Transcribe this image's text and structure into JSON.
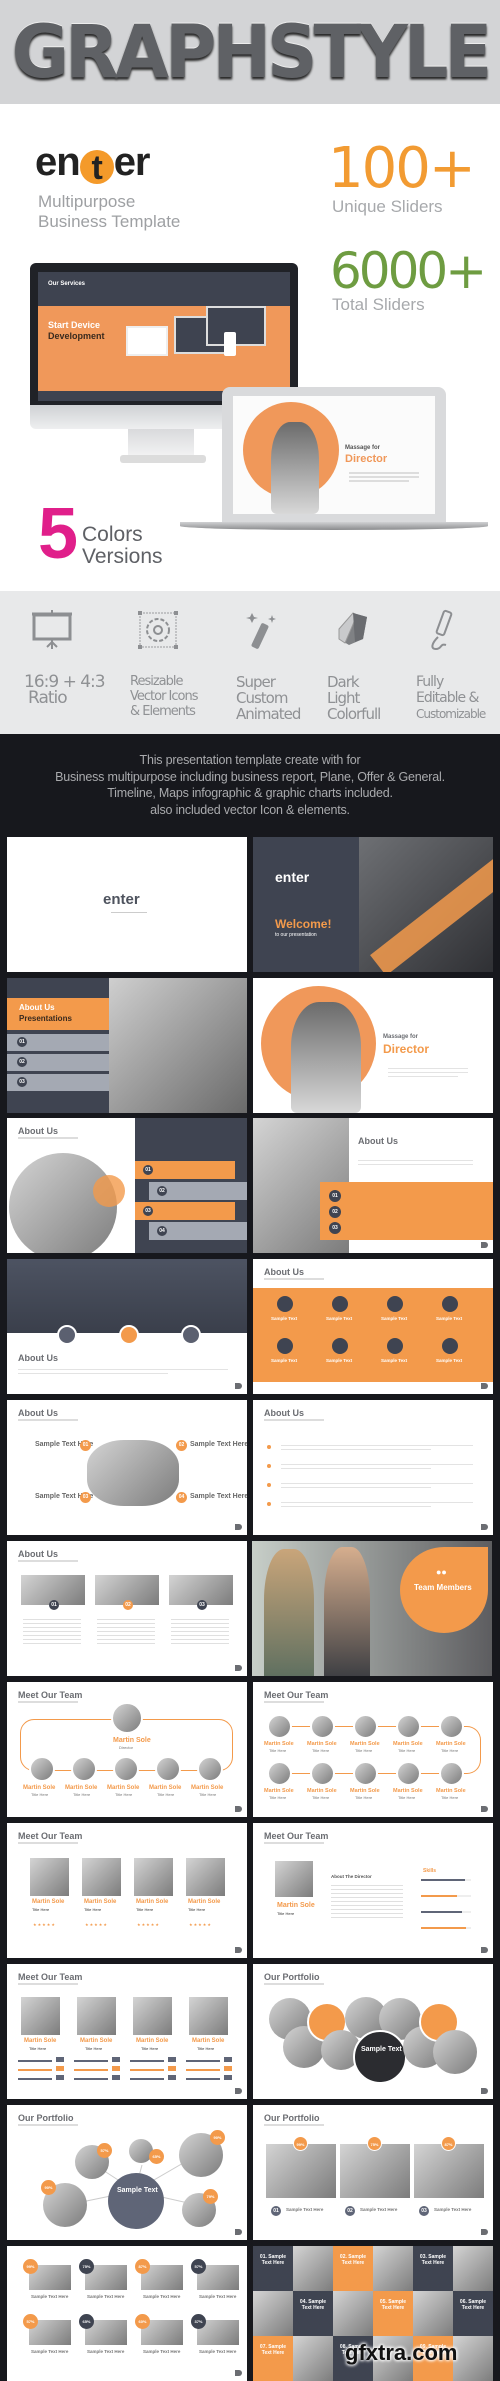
{
  "header": {
    "title": "GRAPHSTYLE"
  },
  "promo": {
    "logo_prefix": "en",
    "logo_mid": "t",
    "logo_suffix": "er",
    "tagline_line1": "Multipurpose",
    "tagline_line2": "Business Template",
    "stat1_value": "100+",
    "stat1_label": "Unique Sliders",
    "stat2_value": "6000+",
    "stat2_label": "Total Sliders",
    "colors_number": "5",
    "colors_line1": "Colors",
    "colors_line2": "Versions",
    "imac_screen": {
      "title": "Our Services",
      "heading1": "Start Device",
      "heading2": "Development"
    },
    "laptop_screen": {
      "pre": "Massage for",
      "heading": "Director"
    },
    "accent_orange": "#f39a4b",
    "accent_green": "#6e9c41",
    "accent_pink": "#e01f8a"
  },
  "features": [
    {
      "icon": "projector-screen-icon",
      "lines": [
        "16:9 + 4:3",
        "Ratio"
      ]
    },
    {
      "icon": "vector-gear-icon",
      "lines": [
        "Resizable",
        "Vector Icons",
        "& Elements"
      ]
    },
    {
      "icon": "magic-wand-icon",
      "lines": [
        "Super",
        "Custom",
        "Animated"
      ]
    },
    {
      "icon": "color-swatch-icon",
      "lines": [
        "Dark",
        "Light",
        "Colorfull"
      ]
    },
    {
      "icon": "pencil-edit-icon",
      "lines": [
        "Fully",
        "Editable &",
        "Customizable"
      ]
    }
  ],
  "description": [
    "This presentation template create with for",
    "Business multipurpose including business report, Plane, Offer & General.",
    "Timeline, Maps infographic & graphic charts included.",
    "also included vector Icon & elements."
  ],
  "slides": {
    "s1": {
      "logo": "enter"
    },
    "s2": {
      "logo": "enter",
      "heading": "Welcome!",
      "sub": "to our presentation"
    },
    "s3": {
      "heading1": "About Us",
      "heading2": "Presentations",
      "items": [
        "01",
        "02",
        "03"
      ]
    },
    "s4": {
      "pre": "Massage for",
      "heading": "Director"
    },
    "s5": {
      "title": "About Us",
      "items": [
        "01",
        "02",
        "03",
        "04"
      ]
    },
    "s6": {
      "title": "About Us",
      "items": [
        "01",
        "02",
        "03"
      ]
    },
    "s7": {
      "title": "About Us"
    },
    "s8": {
      "title": "About Us",
      "item_label": "Sample Text"
    },
    "s9": {
      "title": "About Us",
      "item_label": "Sample Text Here",
      "items": [
        "01",
        "02",
        "03",
        "04"
      ]
    },
    "s10": {
      "title": "About Us"
    },
    "s11": {
      "title": "About Us",
      "items": [
        "01",
        "02",
        "03"
      ]
    },
    "s12": {
      "heading": "Team Members"
    },
    "s13": {
      "title": "Meet Our Team",
      "name": "Martin Sole",
      "role": "Director",
      "member_role": "Title Here"
    },
    "s14": {
      "title": "Meet Our Team",
      "name": "Martin Sole",
      "role": "Title Here"
    },
    "s15": {
      "title": "Meet Our Team",
      "name": "Martin Sole",
      "role": "Title Here"
    },
    "s16": {
      "title": "Meet Our Team",
      "name": "Martin Sole",
      "role": "Title Here",
      "about": "About The Director",
      "skills": "Skills"
    },
    "s17": {
      "title": "Meet Our Team",
      "name": "Martin Sole",
      "role": "Title Here"
    },
    "s18": {
      "title": "Our Portfolio",
      "center": "Sample Text"
    },
    "s19": {
      "title": "Our Portfolio",
      "center": "Sample Text",
      "percents": [
        "57%",
        "65%",
        "90%",
        "90%",
        "79%"
      ]
    },
    "s20": {
      "title": "Our Portfolio",
      "item_label": "Sample Text Here",
      "percents": [
        "99%",
        "75%",
        "87%"
      ],
      "items": [
        "01",
        "02",
        "03"
      ]
    },
    "s21": {
      "item_label": "Sample Text Here",
      "percents": [
        "99%",
        "75%",
        "87%",
        "57%",
        "57%",
        "65%",
        "60%",
        "37%"
      ]
    },
    "s22": {
      "tiles": [
        "01. Sample Text Here",
        "02. Sample Text Here",
        "03. Sample Text Here",
        "04. Sample Text Here",
        "05. Sample Text Here",
        "06. Sample Text Here",
        "07. Sample Text Here",
        "08. Sample Text Here",
        "09. Sample Text Here"
      ]
    }
  },
  "watermark": "gfxtra.com"
}
